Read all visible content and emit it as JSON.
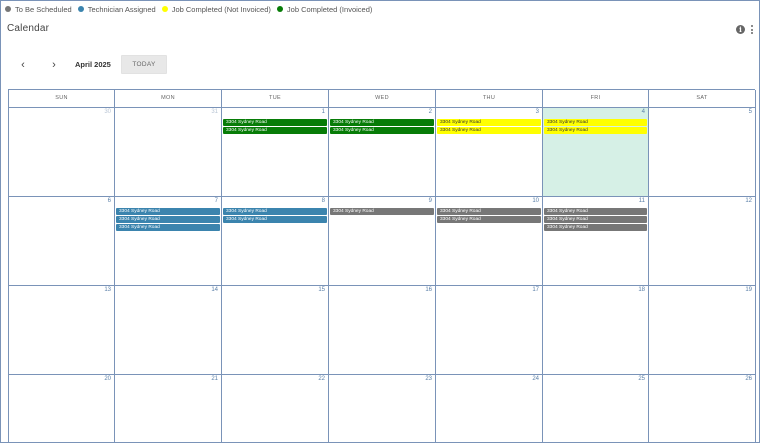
{
  "legend": [
    {
      "label": "To Be Scheduled",
      "color": "#777777"
    },
    {
      "label": "Technician Assigned",
      "color": "#3b84ae"
    },
    {
      "label": "Job Completed (Not Invoiced)",
      "color": "#ffff00"
    },
    {
      "label": "Job Completed (Invoiced)",
      "color": "#077c07"
    }
  ],
  "header": {
    "title": "Calendar",
    "info_icon": "info-icon",
    "menu_icon": "kebab-menu-icon"
  },
  "toolbar": {
    "prev": "‹",
    "next": "›",
    "month_label": "April 2025",
    "today_label": "TODAY"
  },
  "calendar": {
    "weekdays": [
      "SUN",
      "MON",
      "TUE",
      "WED",
      "THU",
      "FRI",
      "SAT"
    ],
    "weeks": [
      [
        {
          "day": "30",
          "muted": true,
          "events": []
        },
        {
          "day": "31",
          "muted": true,
          "events": []
        },
        {
          "day": "1",
          "events": [
            {
              "title": "3304 Sydney Road",
              "status": "invoiced"
            },
            {
              "title": "3304 Sydney Road",
              "status": "invoiced"
            }
          ]
        },
        {
          "day": "2",
          "events": [
            {
              "title": "3304 Sydney Road",
              "status": "invoiced"
            },
            {
              "title": "3304 Sydney Road",
              "status": "invoiced"
            }
          ]
        },
        {
          "day": "3",
          "events": [
            {
              "title": "3304 Sydney Road",
              "status": "not-invoiced"
            },
            {
              "title": "3304 Sydney Road",
              "status": "not-invoiced"
            }
          ]
        },
        {
          "day": "4",
          "today": true,
          "events": [
            {
              "title": "3304 Sydney Road",
              "status": "not-invoiced"
            },
            {
              "title": "3304 Sydney Road",
              "status": "not-invoiced"
            }
          ]
        },
        {
          "day": "5",
          "events": []
        }
      ],
      [
        {
          "day": "6",
          "events": []
        },
        {
          "day": "7",
          "events": [
            {
              "title": "3304 Sydney Road",
              "status": "assigned"
            },
            {
              "title": "3304 Sydney Road",
              "status": "assigned"
            },
            {
              "title": "3304 Sydney Road",
              "status": "assigned"
            }
          ]
        },
        {
          "day": "8",
          "events": [
            {
              "title": "3304 Sydney Road",
              "status": "assigned"
            },
            {
              "title": "3304 Sydney Road",
              "status": "assigned"
            }
          ]
        },
        {
          "day": "9",
          "events": [
            {
              "title": "3304 Sydney Road",
              "status": "scheduled"
            }
          ]
        },
        {
          "day": "10",
          "events": [
            {
              "title": "3304 Sydney Road",
              "status": "scheduled"
            },
            {
              "title": "3304 Sydney Road",
              "status": "scheduled"
            }
          ]
        },
        {
          "day": "11",
          "events": [
            {
              "title": "3304 Sydney Road",
              "status": "scheduled"
            },
            {
              "title": "3304 Sydney Road",
              "status": "scheduled"
            },
            {
              "title": "3304 Sydney Road",
              "status": "scheduled"
            }
          ]
        },
        {
          "day": "12",
          "events": []
        }
      ],
      [
        {
          "day": "13",
          "events": []
        },
        {
          "day": "14",
          "events": []
        },
        {
          "day": "15",
          "events": []
        },
        {
          "day": "16",
          "events": []
        },
        {
          "day": "17",
          "events": []
        },
        {
          "day": "18",
          "events": []
        },
        {
          "day": "19",
          "events": []
        }
      ],
      [
        {
          "day": "20",
          "events": []
        },
        {
          "day": "21",
          "events": []
        },
        {
          "day": "22",
          "events": []
        },
        {
          "day": "23",
          "events": []
        },
        {
          "day": "24",
          "events": []
        },
        {
          "day": "25",
          "events": []
        },
        {
          "day": "26",
          "events": []
        }
      ]
    ]
  }
}
